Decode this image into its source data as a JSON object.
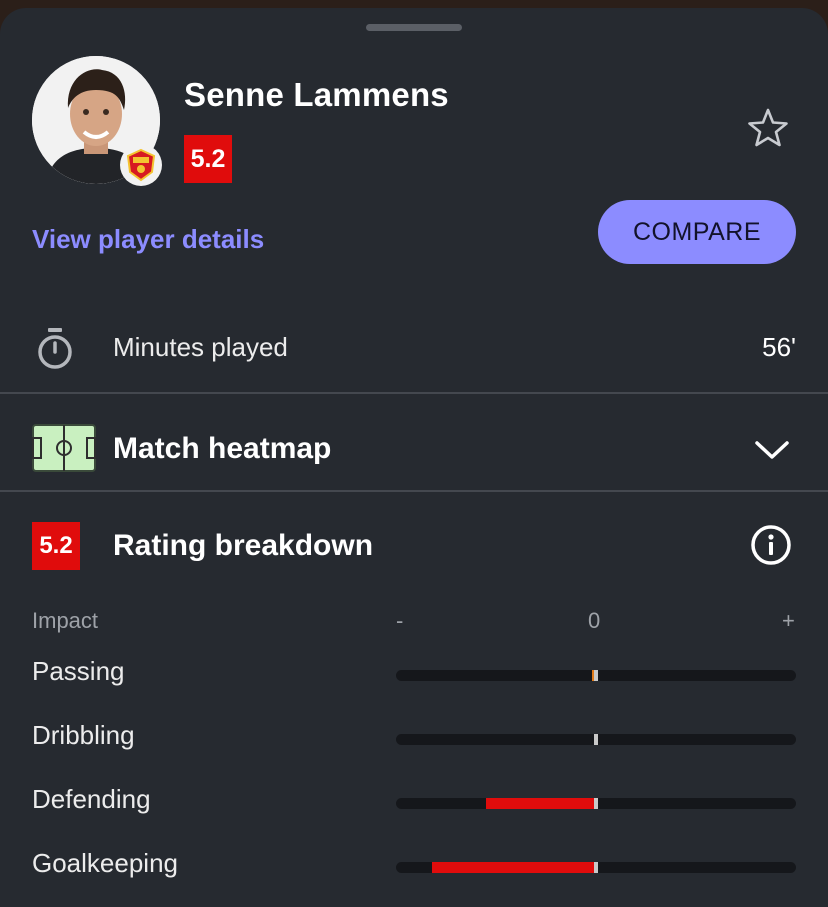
{
  "player": {
    "name": "Senne Lammens",
    "rating": "5.2"
  },
  "actions": {
    "details_link": "View player details",
    "compare_label": "COMPARE"
  },
  "minutes": {
    "label": "Minutes played",
    "value": "56'"
  },
  "heatmap": {
    "title": "Match heatmap"
  },
  "rating_breakdown": {
    "badge": "5.2",
    "title": "Rating breakdown",
    "impact_label": "Impact",
    "scale": {
      "negative": "-",
      "zero": "0",
      "positive": "+"
    },
    "rows": [
      {
        "name": "Passing",
        "impact": -0.02,
        "fill_color": "#e07a1a"
      },
      {
        "name": "Dribbling",
        "impact": 0.0,
        "fill_color": "#e00c0c"
      },
      {
        "name": "Defending",
        "impact": -0.55,
        "fill_color": "#e00c0c"
      },
      {
        "name": "Goalkeeping",
        "impact": -0.82,
        "fill_color": "#e00c0c"
      }
    ]
  },
  "colors": {
    "accent": "#8c8cff",
    "rating_red": "#e00c0c",
    "background": "#262a30"
  },
  "icons": [
    "star-icon",
    "stopwatch-icon",
    "pitch-icon",
    "chevron-down-icon",
    "info-icon",
    "club-crest-icon"
  ]
}
